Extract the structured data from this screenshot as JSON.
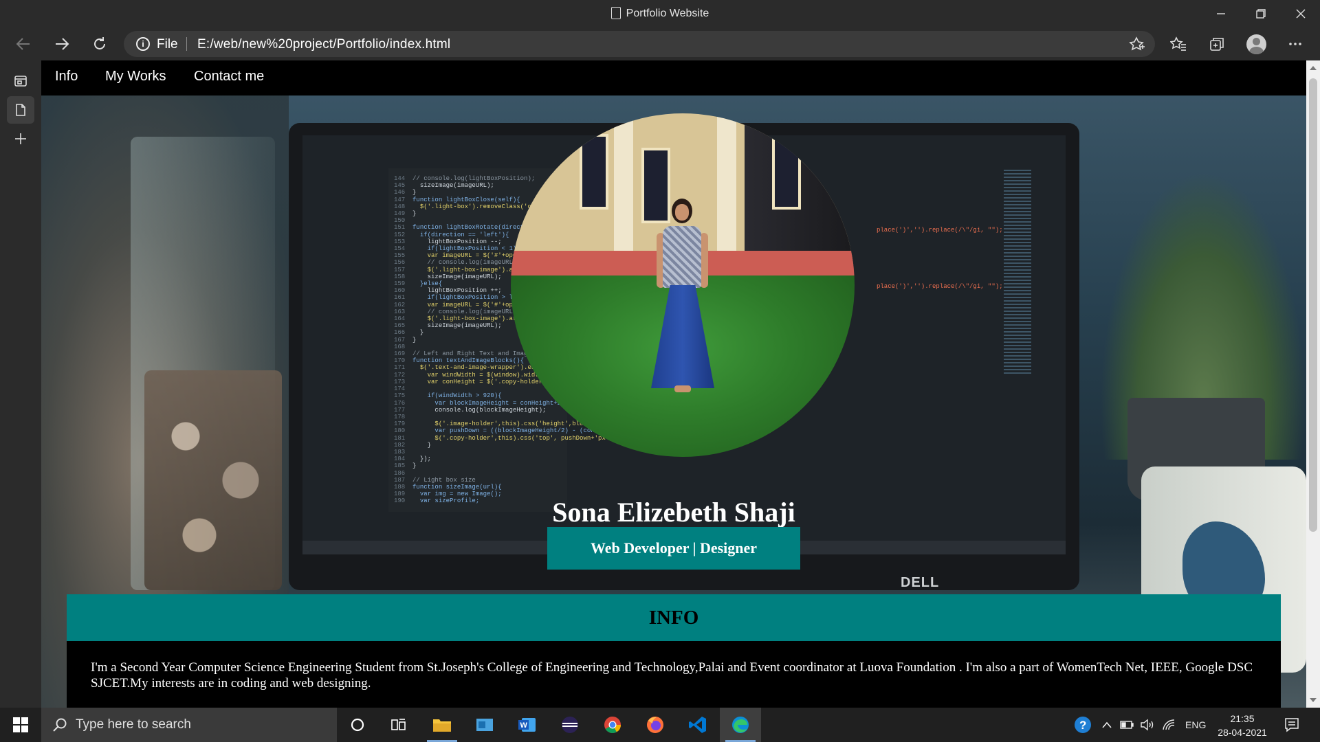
{
  "window": {
    "title": "Portfolio Website"
  },
  "browser": {
    "protocol": "File",
    "url": "E:/web/new%20project/Portfolio/index.html"
  },
  "site": {
    "nav": [
      "Info",
      "My Works",
      "Contact me"
    ],
    "name": "Sona Elizebeth Shaji",
    "role": "Web Developer | Designer",
    "info_heading": "INFO",
    "info_text": "I'm a Second Year Computer Science Engineering Student from St.Joseph's College of Engineering and Technology,Palai and Event coordinator at Luova Foundation . I'm also a part of WomenTech Net, IEEE, Google DSC SJCET.My interests are in coding and web designing.",
    "accent_color": "#008080"
  },
  "background_image": {
    "code_lines": [
      "// console.log(lightBoxPosition);",
      "  sizeImage(imageURL);",
      "}",
      "function lightBoxClose(self){",
      "  $('.light-box').removeClass('open",
      "}",
      "",
      "function lightBoxRotate(directio",
      "  if(direction == 'left'){",
      "    lightBoxPosition --;",
      "    if(lightBoxPosition < 1){",
      "    var imageURL = $('#'+open",
      "    // console.log(imageURL);",
      "    $('.light-box-image').at",
      "    sizeImage(imageURL);",
      "  }else{",
      "    lightBoxPosition ++;",
      "    if(lightBoxPosition > li",
      "    var imageURL = $('#'+open",
      "    // console.log(imageURL);",
      "    $('.light-box-image').att",
      "    sizeImage(imageURL);",
      "  }",
      "}",
      "",
      "// Left and Right Text and Image",
      "function textAndImageBlocks(){",
      "  $('.text-and-image-wrapper').each",
      "    var windWidth = $(window).width",
      "    var conHeight = $('.copy-holder',",
      "",
      "    if(windWidth > 920){",
      "      var blockImageHeight = conHeight+250;",
      "      console.log(blockImageHeight);",
      "",
      "      $('.image-holder',this).css('height',blockImag",
      "      var pushDown = ((blockImageHeight/2) - (conHeight",
      "      $('.copy-holder',this).css('top', pushDown+'px');",
      "    }",
      "",
      "  });",
      "}",
      "",
      "// Light box size",
      "function sizeImage(url){",
      "  var img = new Image();",
      "  var sizeProfile;"
    ],
    "line_numbers_start": 144,
    "code_right": "place(')','').replace(/\\\"/gi, \"\");",
    "laptop_brand": "DELL"
  },
  "taskbar": {
    "search_placeholder": "Type here to search",
    "language": "ENG",
    "time": "21:35",
    "date": "28-04-2021"
  }
}
